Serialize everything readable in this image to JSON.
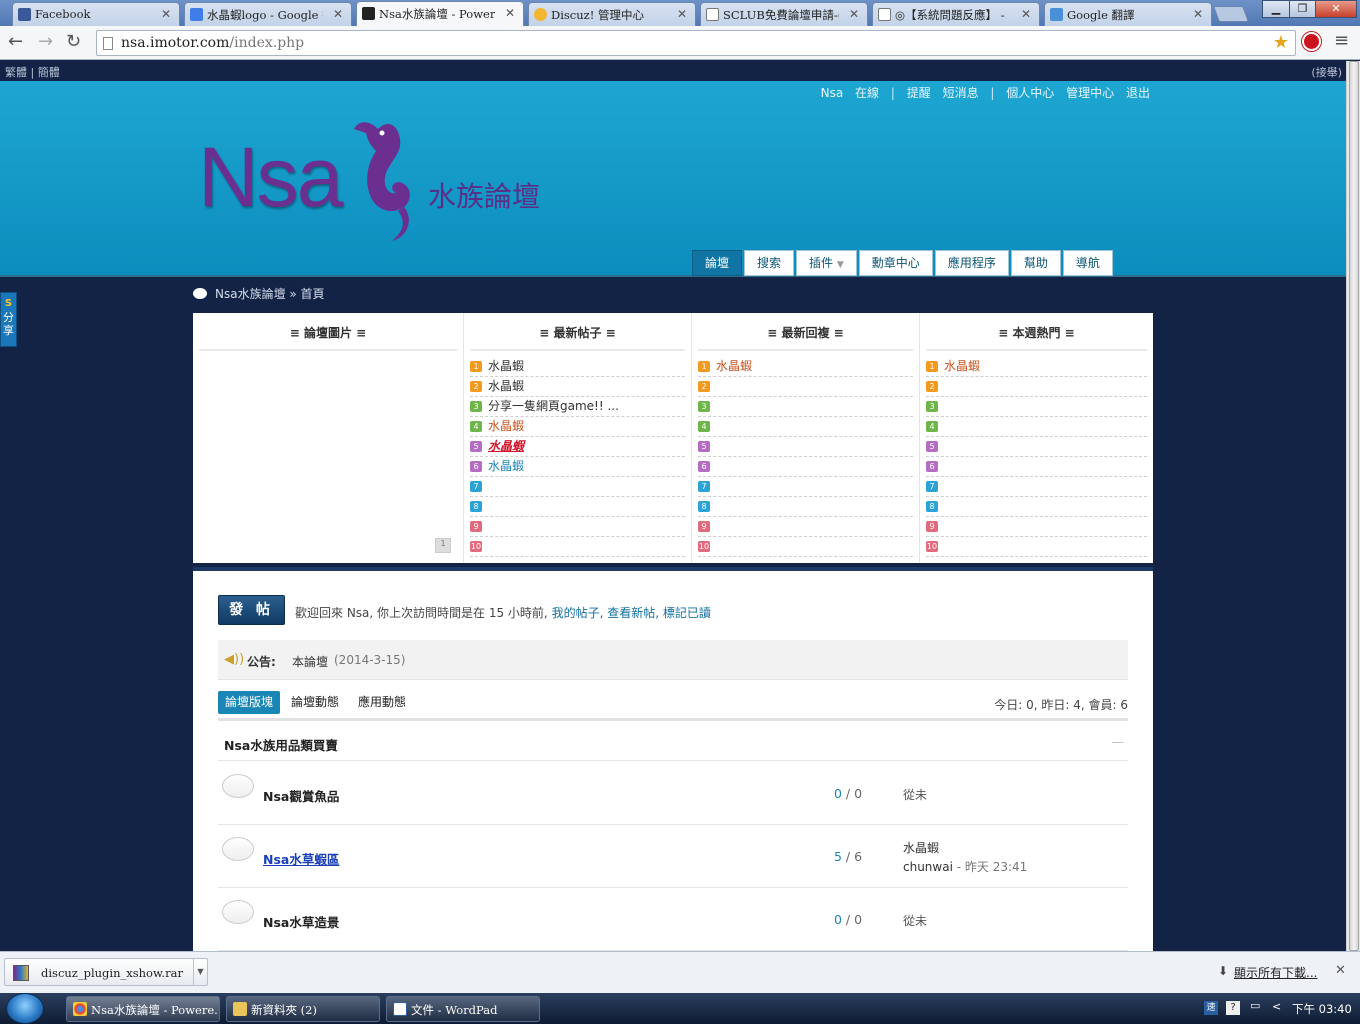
{
  "browser": {
    "tabs": [
      {
        "title": "Facebook",
        "icon": "facebook-icon",
        "color": "#3b5998"
      },
      {
        "title": "水晶蝦logo - Google 搜",
        "icon": "google-icon",
        "color": "#3f7ee8"
      },
      {
        "title": "Nsa水族論壇 - Powered",
        "icon": "nsa-icon",
        "color": "#222222"
      },
      {
        "title": "Discuz! 管理中心",
        "icon": "discuz-icon",
        "color": "#f2b632"
      },
      {
        "title": "SCLUB免費論壇申請-(",
        "icon": "page-icon",
        "color": "#ffffff"
      },
      {
        "title": "◎【系統問題反應】 -",
        "icon": "page-icon",
        "color": "#ffffff"
      },
      {
        "title": "Google 翻譯",
        "icon": "translate-icon",
        "color": "#4a90d9"
      }
    ],
    "url_host": "nsa.imotor.com",
    "url_path": "/index.php"
  },
  "site": {
    "topbar_left": "繁體 | 簡體",
    "topbar_right": "(接舉)",
    "user": {
      "name": "Nsa",
      "status": "在線",
      "links": [
        "提醒",
        "短消息",
        "個人中心",
        "管理中心",
        "退出"
      ]
    },
    "logo": {
      "text": "Nsa",
      "subtitle": "水族論壇"
    },
    "nav": [
      "論壇",
      "搜索",
      "插件",
      "勳章中心",
      "應用程序",
      "幫助",
      "導航"
    ],
    "breadcrumb": "Nsa水族論壇 » 首頁",
    "share_label": "分享",
    "portal": {
      "columns": [
        "≡ 論壇圖片 ≡",
        "≡ 最新帖子 ≡",
        "≡ 最新回複 ≡",
        "≡ 本週熱門 ≡"
      ],
      "latest_posts": [
        "水晶蝦",
        "水晶蝦",
        "分享一隻網頁game!! ...",
        "水晶蝦",
        "水晶蝦",
        "水晶蝦",
        "",
        "",
        "",
        ""
      ],
      "latest_replies": [
        "水晶蝦",
        "",
        "",
        "",
        "",
        "",
        "",
        "",
        "",
        ""
      ],
      "weekly_hot": [
        "水晶蝦",
        "",
        "",
        "",
        "",
        "",
        "",
        "",
        "",
        ""
      ],
      "numbers": [
        "1",
        "2",
        "3",
        "4",
        "5",
        "6",
        "7",
        "8",
        "9",
        "10"
      ],
      "number_colors": [
        "#f39a1e",
        "#f39a1e",
        "#6fb64a",
        "#6fb64a",
        "#b56dc4",
        "#b56dc4",
        "#2ba3d6",
        "#2ba3d6",
        "#e26a7d",
        "#e26a7d"
      ]
    },
    "post_button": "發 帖",
    "welcome": {
      "text": "歡迎回來 Nsa, 你上次訪問時間是在 15 小時前,",
      "links": [
        "我的帖子,",
        "查看新帖,",
        "標記已讀"
      ]
    },
    "notice": {
      "label": "公告:",
      "title": "本論壇",
      "date": "(2014-3-15)"
    },
    "forum_tabs": [
      "論壇版塊",
      "論壇動態",
      "應用動態"
    ],
    "stats": "今日: 0, 昨日: 4, 會員: 6",
    "category": "Nsa水族用品類買賣",
    "collapse": "—",
    "forums": [
      {
        "name": "Nsa觀賞魚品",
        "threads": "0",
        "posts": "0",
        "last_line1": "從未",
        "last_line2": "",
        "last_time": ""
      },
      {
        "name": "Nsa水草蝦區",
        "threads": "5",
        "posts": "6",
        "last_line1": "水晶蝦",
        "last_line2": "chunwai",
        "last_time": " - 昨天 23:41"
      },
      {
        "name": "Nsa水草造景",
        "threads": "0",
        "posts": "0",
        "last_line1": "從未",
        "last_line2": "",
        "last_time": ""
      }
    ]
  },
  "download": {
    "file": "discuz_plugin_xshow.rar",
    "show_all": "顯示所有下載..."
  },
  "taskbar": {
    "items": [
      "Nsa水族論壇 - Powere...",
      "新資料夾 (2)",
      "文件 - WordPad"
    ],
    "clock": "下午 03:40"
  },
  "colors": {
    "header": "#1ea6d2",
    "page_bg": "#122346",
    "accent": "#1a86b6",
    "logo_purple": "#6b2f8f"
  }
}
